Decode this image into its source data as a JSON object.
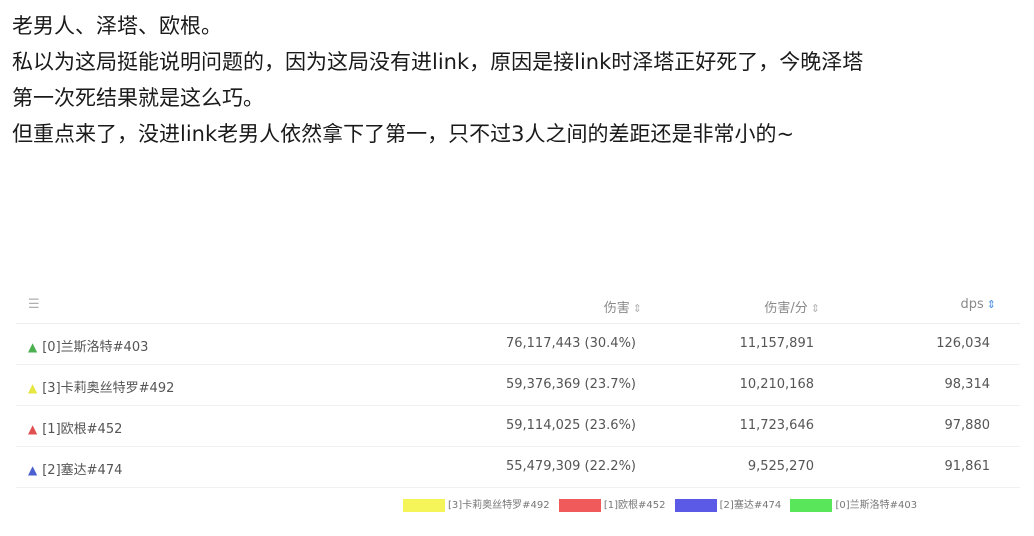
{
  "post": {
    "lines": [
      "老男人、泽塔、欧根。",
      "私以为这局挺能说明问题的，因为这局没有进link，原因是接link时泽塔正好死了，今晚泽塔",
      "第一次死结果就是这么巧。",
      "但重点来了，没进link老男人依然拿下了第一，只不过3人之间的差距还是非常小的~"
    ]
  },
  "table": {
    "filter_icon": "filter-icon",
    "headers": {
      "damage": "伤害",
      "dpm": "伤害/分",
      "dps": "dps"
    },
    "sort_glyph": "⇕",
    "rows": [
      {
        "name": "[0]兰斯洛特#403",
        "damage": "76,117,443 (30.4%)",
        "dpm": "11,157,891",
        "dps": "126,034",
        "color": "#4caf50"
      },
      {
        "name": "[3]卡莉奥丝特罗#492",
        "damage": "59,376,369 (23.7%)",
        "dpm": "10,210,168",
        "dps": "98,314",
        "color": "#e6e640"
      },
      {
        "name": "[1]欧根#452",
        "damage": "59,114,025 (23.6%)",
        "dpm": "11,723,646",
        "dps": "97,880",
        "color": "#e05050"
      },
      {
        "name": "[2]塞达#474",
        "damage": "55,479,309 (22.2%)",
        "dpm": "9,525,270",
        "dps": "91,861",
        "color": "#4a5fd0"
      }
    ]
  },
  "legend": [
    {
      "label": "[3]卡莉奥丝特罗#492",
      "color": "#f5f55a"
    },
    {
      "label": "[1]欧根#452",
      "color": "#f05a5a"
    },
    {
      "label": "[2]塞达#474",
      "color": "#5a5ae6"
    },
    {
      "label": "[0]兰斯洛特#403",
      "color": "#5ae65a"
    }
  ]
}
